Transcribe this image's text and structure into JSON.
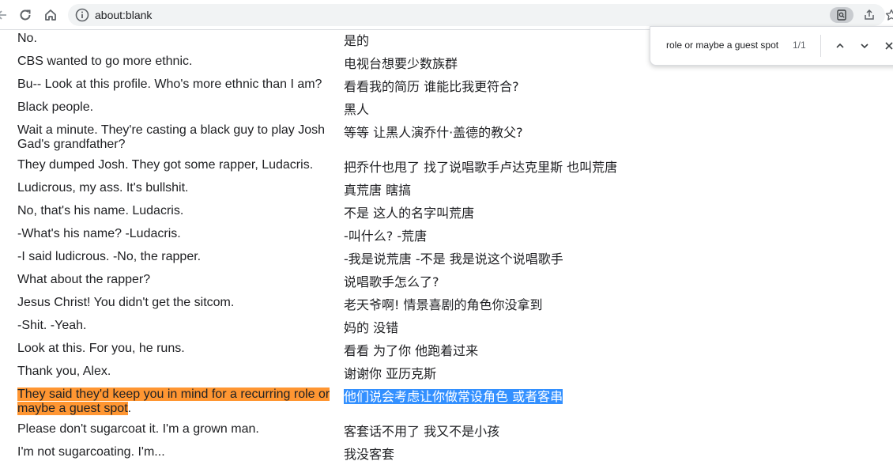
{
  "browser": {
    "url": "about:blank",
    "nav_icons": [
      "back-arrow-icon",
      "reload-icon",
      "home-icon",
      "info-icon"
    ],
    "right_icons": [
      "find-in-page-icon",
      "share-icon",
      "bookmark-star-icon"
    ]
  },
  "find_bar": {
    "query": "role or maybe a guest spot",
    "count": "1/1"
  },
  "colors": {
    "active_match": "#ff9632",
    "selection": "#3390ff"
  },
  "subtitles": [
    {
      "en": "No.",
      "zh": "是的"
    },
    {
      "en": "CBS wanted to go more ethnic.",
      "zh": "电视台想要少数族群"
    },
    {
      "en": "Bu-- Look at this profile. Who's more ethnic than I am?",
      "zh": "看看我的简历 谁能比我更符合?"
    },
    {
      "en": "Black people.",
      "zh": "黑人"
    },
    {
      "en": "Wait a minute. They're casting a black guy to play Josh Gad's grandfather?",
      "zh": "等等 让黑人演乔什·盖德的教父?"
    },
    {
      "en": "They dumped Josh. They got some rapper, Ludacris.",
      "zh": "把乔什也甩了 找了说唱歌手卢达克里斯 也叫荒唐"
    },
    {
      "en": "Ludicrous, my ass. It's bullshit.",
      "zh": "真荒唐 瞎搞"
    },
    {
      "en": "No, that's his name. Ludacris.",
      "zh": "不是 这人的名字叫荒唐"
    },
    {
      "en": "-What's his name? -Ludacris.",
      "zh": "-叫什么? -荒唐"
    },
    {
      "en": "-I said ludicrous. -No, the rapper.",
      "zh": "-我是说荒唐 -不是 我是说这个说唱歌手"
    },
    {
      "en": "What about the rapper?",
      "zh": "说唱歌手怎么了?"
    },
    {
      "en": "Jesus Christ! You didn't get the sitcom.",
      "zh": "老天爷啊! 情景喜剧的角色你没拿到"
    },
    {
      "en": "-Shit. -Yeah.",
      "zh": "妈的 没错"
    },
    {
      "en": "Look at this. For you, he runs.",
      "zh": "看看 为了你 他跑着过来"
    },
    {
      "en": "Thank you, Alex.",
      "zh": "谢谢你 亚历克斯"
    },
    {
      "en": "They said they'd keep you in mind for a recurring role or maybe a guest spot.",
      "zh": "他们说会考虑让你做常设角色 或者客串"
    },
    {
      "en": "Please don't sugarcoat it. I'm a grown man.",
      "zh": "客套话不用了 我又不是小孩"
    },
    {
      "en": "I'm not sugarcoating. I'm...",
      "zh": "我没客套"
    }
  ],
  "highlight_row": {
    "en_match": "They said they'd keep you in mind for a recurring role or maybe a guest spot",
    "en_tail": ".",
    "zh_selected": "他们说会考虑让你做常设角色 或者客串"
  }
}
